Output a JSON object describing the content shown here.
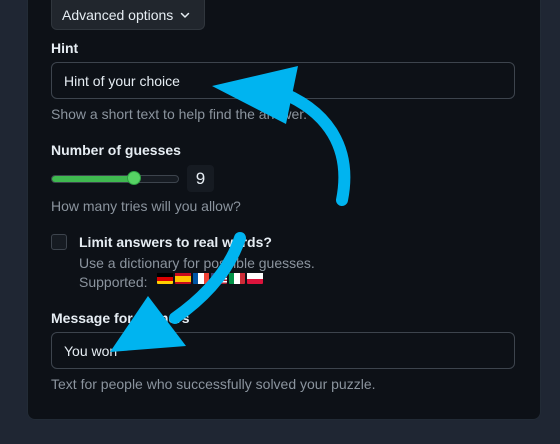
{
  "advanced": {
    "label": "Advanced options"
  },
  "hint": {
    "label": "Hint",
    "value": "Hint of your choice",
    "helper": "Show a short text to help find the answer."
  },
  "guesses": {
    "label": "Number of guesses",
    "value": "9",
    "level": 0.65,
    "helper": "How many tries will you allow?"
  },
  "limit": {
    "label": "Limit answers to real words?",
    "helper": "Use a dictionary for possible guesses.",
    "supported_label": "Supported:",
    "flags": [
      "german-flag-icon",
      "spanish-flag-icon",
      "french-flag-icon",
      "english-flag-icon",
      "italian-flag-icon",
      "polish-flag-icon"
    ]
  },
  "win": {
    "label": "Message for winners",
    "value": "You won",
    "helper": "Text for people who successfully solved your puzzle."
  },
  "colors": {
    "accent_green": "#3fb950",
    "arrow_blue": "#00b4f0",
    "panel_bg": "#0d1117"
  }
}
